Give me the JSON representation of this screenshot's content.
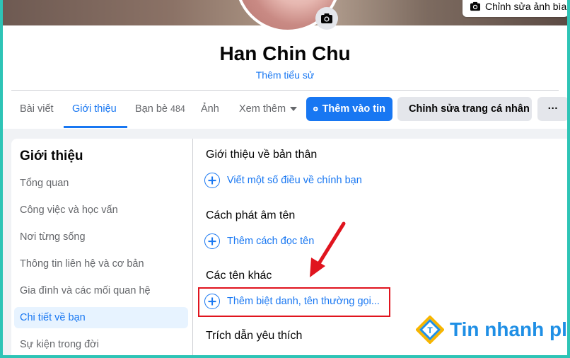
{
  "profile": {
    "name": "Han Chin Chu",
    "add_bio": "Thêm tiểu sử",
    "edit_cover": "Chỉnh sửa ảnh bìa"
  },
  "tabs": [
    {
      "label": "Bài viết"
    },
    {
      "label": "Giới thiệu"
    },
    {
      "label": "Bạn bè",
      "count": "484"
    },
    {
      "label": "Ảnh"
    },
    {
      "label": "Xem thêm"
    }
  ],
  "actions": {
    "add_story": "Thêm vào tin",
    "edit_profile": "Chỉnh sửa trang cá nhân",
    "more": "···"
  },
  "about_menu": {
    "title": "Giới thiệu",
    "items": [
      {
        "label": "Tổng quan"
      },
      {
        "label": "Công việc và học vấn"
      },
      {
        "label": "Nơi từng sống"
      },
      {
        "label": "Thông tin liên hệ và cơ bản"
      },
      {
        "label": "Gia đình và các mối quan hệ"
      },
      {
        "label": "Chi tiết về bạn",
        "active": true
      },
      {
        "label": "Sự kiện trong đời"
      }
    ]
  },
  "details": {
    "sections": [
      {
        "title": "Giới thiệu về bản thân",
        "action": "Viết một số điều về chính bạn"
      },
      {
        "title": "Cách phát âm tên",
        "action": "Thêm cách đọc tên"
      },
      {
        "title": "Các tên khác",
        "action": "Thêm biệt danh, tên thường gọi..."
      },
      {
        "title": "Trích dẫn yêu thích"
      }
    ]
  },
  "brand": {
    "text": "Tin nhanh plus",
    "logo_letter": "T"
  },
  "colors": {
    "accent": "#1877f2",
    "highlight": "#e0141e",
    "frame": "#2ec4b6"
  },
  "icons": [
    "camera-icon",
    "plus-circle-icon",
    "pencil-icon",
    "caret-down-icon",
    "more-dots-icon"
  ]
}
